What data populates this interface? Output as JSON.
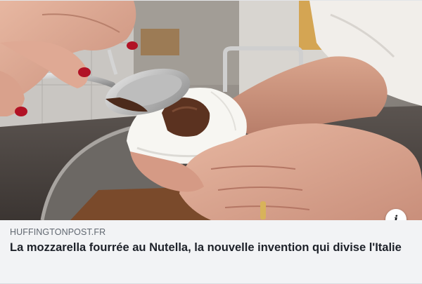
{
  "link_preview": {
    "image_alt": "",
    "info_icon": "info-icon",
    "info_glyph": "i",
    "source": "HUFFINGTONPOST.FR",
    "headline": "La mozzarella fourrée au Nutella, la nouvelle invention qui divise l'Italie"
  },
  "colors": {
    "caption_background": "#f2f3f5",
    "source_text": "#606770",
    "headline_text": "#1d2129"
  }
}
